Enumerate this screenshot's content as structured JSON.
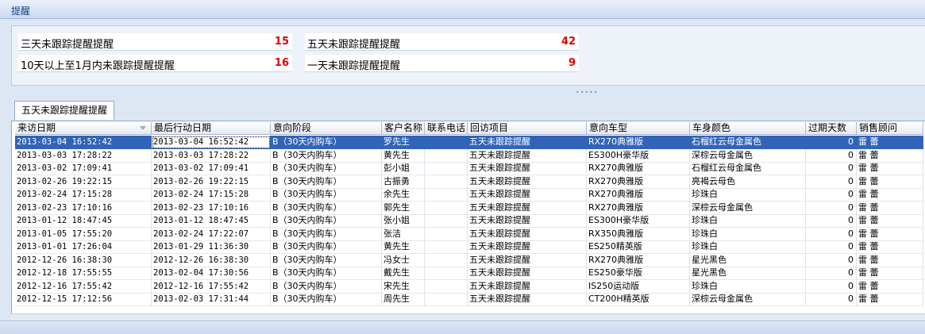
{
  "window": {
    "title": "提醒"
  },
  "summary": [
    {
      "label": "三天未跟踪提醒提醒",
      "count": "15"
    },
    {
      "label": "五天未跟踪提醒提醒",
      "count": "42"
    },
    {
      "label": "10天以上至1月内未跟踪提醒提醒",
      "count": "16"
    },
    {
      "label": "一天未跟踪提醒提醒",
      "count": "9"
    }
  ],
  "tab": {
    "label": "五天未跟踪提醒提醒"
  },
  "grid": {
    "columns": [
      "来访日期",
      "最后行动日期",
      "意向阶段",
      "客户名称",
      "联系电话",
      "回访项目",
      "意向车型",
      "车身颜色",
      "过期天数",
      "销售顾问"
    ],
    "rows": [
      [
        "2013-03-04 16:52:42",
        "2013-03-04 16:52:42",
        "B（30天内购车）",
        "罗先生",
        "",
        "五天未跟踪提醒",
        "RX270典雅版",
        "石榴红云母金属色",
        "0",
        "雷  蕾"
      ],
      [
        "2013-03-03 17:28:22",
        "2013-03-03 17:28:22",
        "B（30天内购车）",
        "黄先生",
        "",
        "五天未跟踪提醒",
        "ES300H豪华版",
        "深棕云母金属色",
        "0",
        "雷  蕾"
      ],
      [
        "2013-03-02 17:09:41",
        "2013-03-02 17:09:41",
        "B（30天内购车）",
        "彭小姐",
        "",
        "五天未跟踪提醒",
        "RX270典雅版",
        "石榴红云母金属色",
        "0",
        "雷  蕾"
      ],
      [
        "2013-02-26 19:22:15",
        "2013-02-26 19:22:15",
        "B（30天内购车）",
        "古振勇",
        "",
        "五天未跟踪提醒",
        "RX270典雅版",
        "亮褐云母色",
        "0",
        "雷  蕾"
      ],
      [
        "2013-02-24 17:15:28",
        "2013-02-24 17:15:28",
        "B（30天内购车）",
        "余先生",
        "",
        "五天未跟踪提醒",
        "RX270典雅版",
        "珍珠白",
        "0",
        "雷  蕾"
      ],
      [
        "2013-02-23 17:10:16",
        "2013-02-23 17:10:16",
        "B（30天内购车）",
        "郭先生",
        "",
        "五天未跟踪提醒",
        "RX270典雅版",
        "深棕云母金属色",
        "0",
        "雷  蕾"
      ],
      [
        "2013-01-12 18:47:45",
        "2013-01-12 18:47:45",
        "B（30天内购车）",
        "张小姐",
        "",
        "五天未跟踪提醒",
        "ES300H豪华版",
        "珍珠白",
        "0",
        "雷  蕾"
      ],
      [
        "2013-01-05 17:55:20",
        "2013-02-24 17:22:07",
        "B（30天内购车）",
        "张洁",
        "",
        "五天未跟踪提醒",
        "RX350典雅版",
        "珍珠白",
        "0",
        "雷  蕾"
      ],
      [
        "2013-01-01 17:26:04",
        "2013-01-29 11:36:30",
        "B（30天内购车）",
        "黄先生",
        "",
        "五天未跟踪提醒",
        "ES250精英版",
        "珍珠白",
        "0",
        "雷  蕾"
      ],
      [
        "2012-12-26 16:38:30",
        "2012-12-26 16:38:30",
        "B（30天内购车）",
        "冯女士",
        "",
        "五天未跟踪提醒",
        "RX270典雅版",
        "星光黑色",
        "0",
        "雷  蕾"
      ],
      [
        "2012-12-18 17:55:55",
        "2013-02-04 17:30:56",
        "B（30天内购车）",
        "戴先生",
        "",
        "五天未跟踪提醒",
        "ES250豪华版",
        "星光黑色",
        "0",
        "雷  蕾"
      ],
      [
        "2012-12-16 17:55:42",
        "2012-12-16 17:55:42",
        "B（30天内购车）",
        "宋先生",
        "",
        "五天未跟踪提醒",
        "IS250运动版",
        "珍珠白",
        "0",
        "雷  蕾"
      ],
      [
        "2012-12-15 17:12:56",
        "2013-02-03 17:31:44",
        "B（30天内购车）",
        "周先生",
        "",
        "五天未跟踪提醒",
        "CT200H精英版",
        "深棕云母金属色",
        "0",
        "雷  蕾"
      ]
    ]
  },
  "colors": {
    "selected_row": "#3163b8",
    "count_text": "#e00000"
  }
}
